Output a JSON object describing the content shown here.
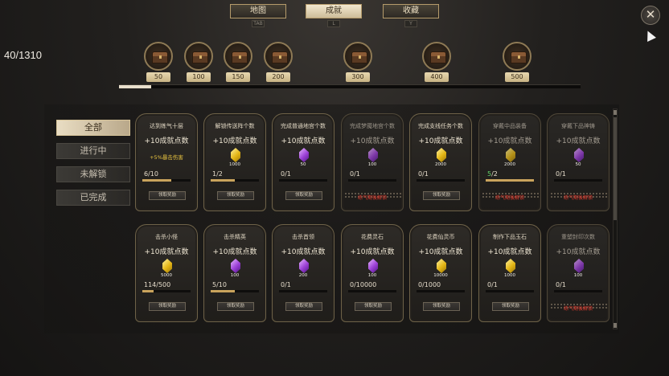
{
  "tabs": [
    {
      "label": "地图",
      "key": "TAB"
    },
    {
      "label": "成就",
      "key": "L"
    },
    {
      "label": "收藏",
      "key": "Y"
    }
  ],
  "close_symbol": "✕",
  "progress_text": "40/1310",
  "milestones": [
    "50",
    "100",
    "150",
    "200",
    "300",
    "400",
    "500"
  ],
  "milestone_progress_fraction": 0.07,
  "filters": [
    "全部",
    "进行中",
    "未解锁",
    "已完成"
  ],
  "cards": [
    {
      "title": "达到练气十层",
      "points": "+10成就点数",
      "bonus": "+5%暴击伤害",
      "gem": "",
      "gem_color": "",
      "progress": "6/10",
      "fraction": 0.6,
      "button": "领取奖励",
      "locked": false,
      "lock_text": ""
    },
    {
      "title": "解锁传送阵个数",
      "points": "+10成就点数",
      "bonus": "",
      "gem": "1000",
      "gem_color": "gold",
      "progress": "1/2",
      "fraction": 0.5,
      "button": "领取奖励",
      "locked": false,
      "lock_text": ""
    },
    {
      "title": "完成普通地宫个数",
      "points": "+10成就点数",
      "bonus": "",
      "gem": "50",
      "gem_color": "purple",
      "progress": "0/1",
      "fraction": 0,
      "button": "领取奖励",
      "locked": false,
      "lock_text": ""
    },
    {
      "title": "完成梦魇地宫个数",
      "points": "+10成就点数",
      "bonus": "",
      "gem": "100",
      "gem_color": "purple",
      "progress": "0/1",
      "fraction": 0,
      "button": "",
      "locked": true,
      "lock_text": "练气期後解锁"
    },
    {
      "title": "完成支线任务个数",
      "points": "+10成就点数",
      "bonus": "",
      "gem": "2000",
      "gem_color": "gold",
      "progress": "0/1",
      "fraction": 0,
      "button": "领取奖励",
      "locked": false,
      "lock_text": ""
    },
    {
      "title": "穿戴中品装备",
      "points": "+10成就点数",
      "bonus": "",
      "gem": "2000",
      "gem_color": "gold",
      "progress": "5/2",
      "progress_highlight": "5",
      "progress_rest": "/2",
      "fraction": 1,
      "button": "",
      "locked": true,
      "lock_text": "练气期後解锁"
    },
    {
      "title": "穿戴下品神铸",
      "points": "+10成就点数",
      "bonus": "",
      "gem": "50",
      "gem_color": "purple",
      "progress": "0/1",
      "fraction": 0,
      "button": "",
      "locked": true,
      "lock_text": "练气期後解锁"
    },
    {
      "title": "击杀小怪",
      "points": "+10成就点数",
      "bonus": "",
      "gem": "5000",
      "gem_color": "gold",
      "progress": "114/500",
      "fraction": 0.23,
      "button": "领取奖励",
      "locked": false,
      "lock_text": ""
    },
    {
      "title": "击杀精英",
      "points": "+10成就点数",
      "bonus": "",
      "gem": "100",
      "gem_color": "purple",
      "progress": "5/10",
      "fraction": 0.5,
      "button": "领取奖励",
      "locked": false,
      "lock_text": ""
    },
    {
      "title": "击杀首领",
      "points": "+10成就点数",
      "bonus": "",
      "gem": "200",
      "gem_color": "purple",
      "progress": "0/1",
      "fraction": 0,
      "button": "领取奖励",
      "locked": false,
      "lock_text": ""
    },
    {
      "title": "花费灵石",
      "points": "+10成就点数",
      "bonus": "",
      "gem": "100",
      "gem_color": "purple",
      "progress": "0/10000",
      "fraction": 0,
      "button": "领取奖励",
      "locked": false,
      "lock_text": ""
    },
    {
      "title": "花费仙灵币",
      "points": "+10成就点数",
      "bonus": "",
      "gem": "10000",
      "gem_color": "gold",
      "progress": "0/1000",
      "fraction": 0,
      "button": "领取奖励",
      "locked": false,
      "lock_text": ""
    },
    {
      "title": "制作下品玉石",
      "points": "+10成就点数",
      "bonus": "",
      "gem": "1000",
      "gem_color": "gold",
      "progress": "0/1",
      "fraction": 0,
      "button": "领取奖励",
      "locked": false,
      "lock_text": ""
    },
    {
      "title": "重塑封印次数",
      "points": "+10成就点数",
      "bonus": "",
      "gem": "100",
      "gem_color": "purple",
      "progress": "0/1",
      "fraction": 0,
      "button": "",
      "locked": true,
      "lock_text": "练气期後解锁"
    }
  ]
}
